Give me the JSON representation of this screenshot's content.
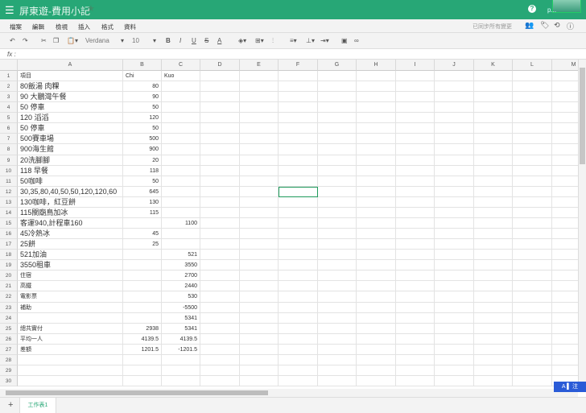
{
  "header": {
    "title": "屏東遊-費用小記",
    "user": "p..."
  },
  "menu": [
    "檔案",
    "編輯",
    "檢視",
    "插入",
    "格式",
    "資料"
  ],
  "sync_status": "已同步所有變更",
  "toolbar": {
    "font": "Verdana",
    "size": "10",
    "bold": "B",
    "italic": "I",
    "underline": "U",
    "strike": "S",
    "color": "A"
  },
  "formula": {
    "label": "fx",
    "value": ""
  },
  "columns": [
    "A",
    "B",
    "C",
    "D",
    "E",
    "F",
    "G",
    "H",
    "I",
    "J",
    "K",
    "L",
    "M"
  ],
  "rows": [
    [
      "項目",
      "Chi",
      "Kuo"
    ],
    [
      "80飯湯 肉粿",
      "80",
      ""
    ],
    [
      "90 大鵬灣午餐",
      "90",
      ""
    ],
    [
      "50 停車",
      "50",
      ""
    ],
    [
      "120 滔滔",
      "120",
      ""
    ],
    [
      "50 停車",
      "50",
      ""
    ],
    [
      "500賽車場",
      "500",
      ""
    ],
    [
      "900海生館",
      "900",
      ""
    ],
    [
      "20洗腳腳",
      "20",
      ""
    ],
    [
      "118 早餐",
      "118",
      ""
    ],
    [
      "50咖啡",
      "50",
      ""
    ],
    [
      "30,35,80,40,50,50,120,120,60",
      "645",
      ""
    ],
    [
      "130咖啡，紅豆餅",
      "130",
      ""
    ],
    [
      "115關廟鳥加冰",
      "115",
      ""
    ],
    [
      "客運940,計程車160",
      "",
      "1100"
    ],
    [
      "45冷熱冰",
      "45",
      ""
    ],
    [
      "25餅",
      "25",
      ""
    ],
    [
      "521加油",
      "",
      "521"
    ],
    [
      "3550租車",
      "",
      "3550"
    ],
    [
      "住宿",
      "",
      "2700"
    ],
    [
      "高鐵",
      "",
      "2440"
    ],
    [
      "電影票",
      "",
      "530"
    ],
    [
      "補助",
      "",
      "-5500"
    ],
    [
      "",
      "",
      "5341"
    ],
    [
      "總共實付",
      "2938",
      "5341"
    ],
    [
      "平均一人",
      "4139.5",
      "4139.5"
    ],
    [
      "差額",
      "1201.5",
      "-1201.5"
    ],
    [
      "",
      "",
      ""
    ],
    [
      "",
      "",
      ""
    ],
    [
      "",
      "",
      ""
    ]
  ],
  "selected_cell": "F12",
  "sheets": [
    "工作表1"
  ],
  "ime": "A ▌ 注"
}
